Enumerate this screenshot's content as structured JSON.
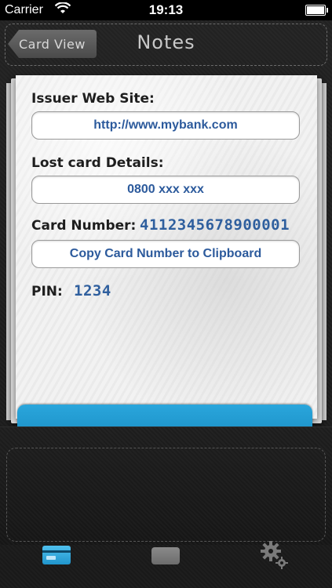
{
  "status_bar": {
    "carrier": "Carrier",
    "time": "19:13"
  },
  "nav": {
    "back_label": "Card View",
    "title": "Notes"
  },
  "notes": {
    "issuer_label": "Issuer Web Site:",
    "issuer_value": "http://www.mybank.com",
    "lost_label": "Lost card Details:",
    "lost_value": "0800 xxx xxx",
    "card_number_label": "Card Number:",
    "card_number_value": "4112345678900001",
    "copy_button": "Copy Card Number to Clipboard",
    "pin_label": "PIN:",
    "pin_value": "1234"
  },
  "tabbar": {
    "tabs": [
      {
        "icon": "credit-card-icon",
        "selected": true
      },
      {
        "icon": "card-icon",
        "selected": false
      },
      {
        "icon": "gears-icon",
        "selected": false
      }
    ]
  },
  "colors": {
    "accent_blue": "#2aa6dc",
    "link_text": "#2c5a9c",
    "handwritten": "#2f5f9e"
  }
}
